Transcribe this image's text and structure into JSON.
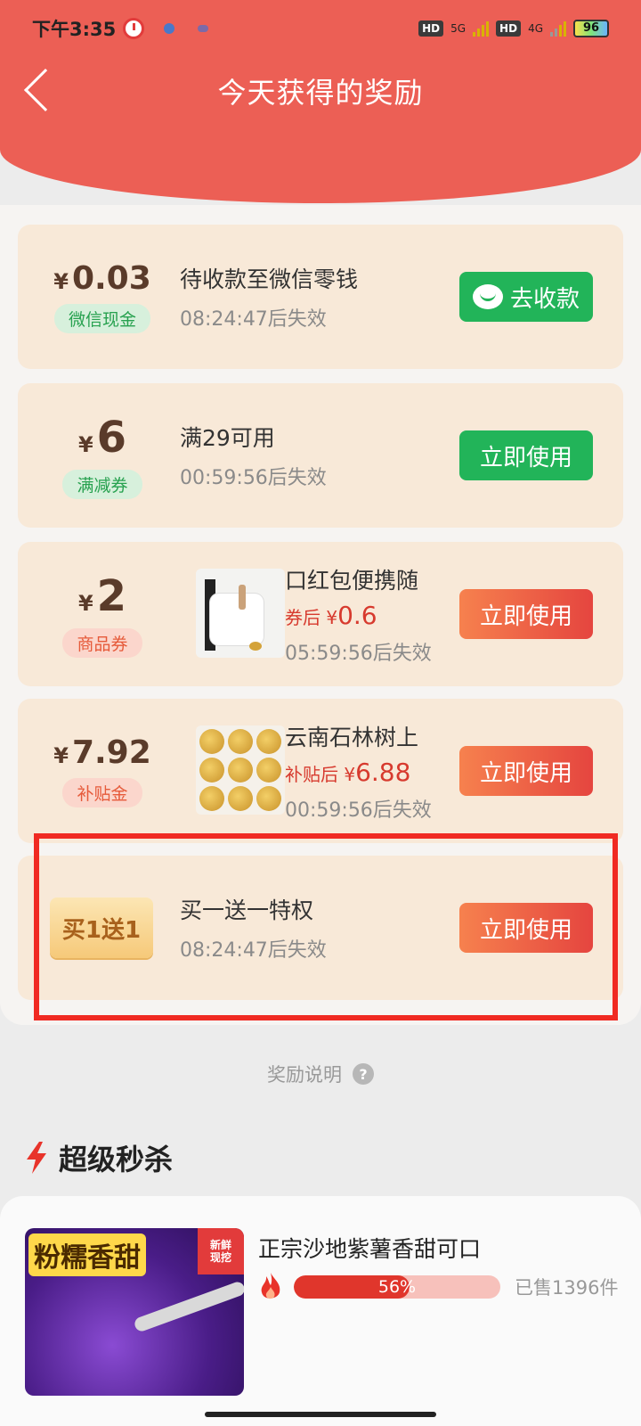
{
  "status_bar": {
    "time": "下午3:35",
    "hd1": "HD",
    "net1": "5G",
    "hd2": "HD",
    "net2": "4G",
    "battery": "96"
  },
  "nav": {
    "title": "今天获得的奖励"
  },
  "rewards": [
    {
      "yen": "¥",
      "amount": "0.03",
      "tag": "微信现金",
      "title": "待收款至微信零钱",
      "expire": "08:24:47后失效",
      "button": "去收款"
    },
    {
      "yen": "¥",
      "amount": "6",
      "tag": "满减券",
      "title": "满29可用",
      "expire": "00:59:56后失效",
      "button": "立即使用"
    },
    {
      "yen": "¥",
      "amount": "2",
      "tag": "商品券",
      "title": "口红包便携随",
      "price_prefix": "券后",
      "price_yen": "¥",
      "price": "0.6",
      "expire": "05:59:56后失效",
      "button": "立即使用"
    },
    {
      "yen": "¥",
      "amount": "7.92",
      "tag": "补贴金",
      "title": "云南石林树上",
      "price_prefix": "补贴后",
      "price_yen": "¥",
      "price": "6.88",
      "expire": "00:59:56后失效",
      "button": "立即使用"
    },
    {
      "badge": "买1送1",
      "title": "买一送一特权",
      "expire": "08:24:47后失效",
      "button": "立即使用"
    }
  ],
  "reward_desc": {
    "label": "奖励说明",
    "help": "?"
  },
  "flash_sale": {
    "title": "超级秒杀",
    "product": {
      "banner": "粉糯香甜",
      "corner_line1": "新鲜",
      "corner_line2": "现挖",
      "title": "正宗沙地紫薯香甜可口",
      "progress_label": "56%",
      "progress_fraction": 0.56,
      "sold": "已售1396件"
    }
  },
  "colors": {
    "header": "#ec5f55",
    "green_button": "#22b459",
    "orange_button": "#e5453f",
    "highlight_border": "#f02a22"
  }
}
